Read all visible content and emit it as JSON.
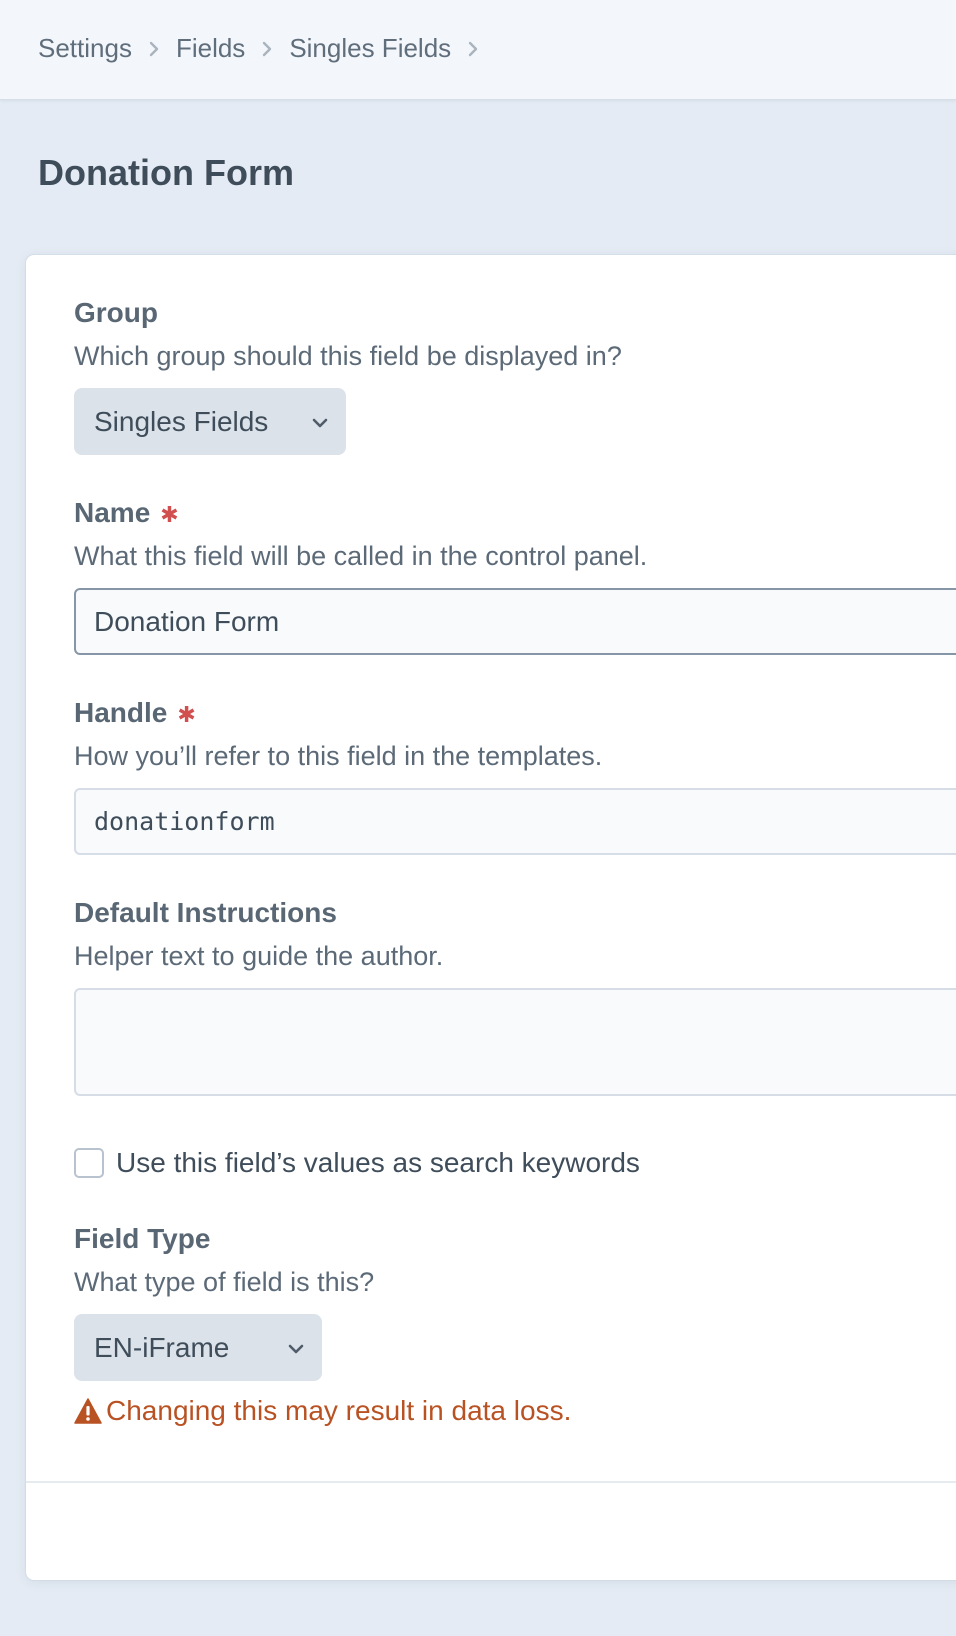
{
  "breadcrumb": {
    "items": [
      "Settings",
      "Fields",
      "Singles Fields"
    ],
    "separator_icon": "chevron-right-icon"
  },
  "page": {
    "title": "Donation Form"
  },
  "form": {
    "group": {
      "label": "Group",
      "help": "Which group should this field be displayed in?",
      "selected": "Singles Fields"
    },
    "name": {
      "label": "Name",
      "required_marker": "✱",
      "help": "What this field will be called in the control panel.",
      "value": "Donation Form"
    },
    "handle": {
      "label": "Handle",
      "required_marker": "✱",
      "help": "How you’ll refer to this field in the templates.",
      "value": "donationform"
    },
    "instructions": {
      "label": "Default Instructions",
      "help": "Helper text to guide the author.",
      "value": ""
    },
    "search_keywords": {
      "label": "Use this field’s values as search keywords",
      "checked": false
    },
    "field_type": {
      "label": "Field Type",
      "help": "What type of field is this?",
      "selected": "EN-iFrame",
      "warning": "Changing this may result in data loss.",
      "warning_icon": "alert-triangle-icon"
    }
  },
  "colors": {
    "background": "#e4ebf4",
    "topbar": "#f3f7fc",
    "required": "#d14f4f",
    "warning": "#b95223",
    "select_bg": "#dbe2ea"
  }
}
